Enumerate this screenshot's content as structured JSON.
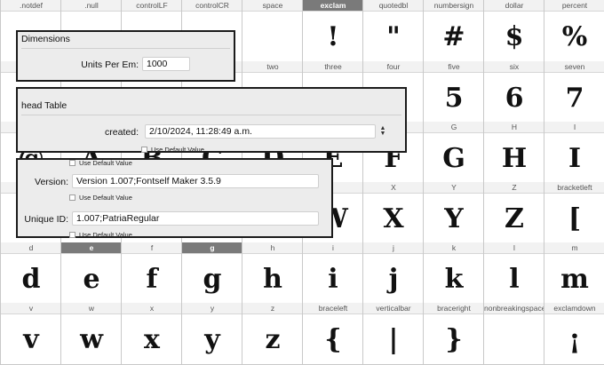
{
  "glyph_grid": {
    "rows": [
      [
        "|.notdef|",
        "|.null|",
        "|controlLF|",
        "|controlCR|",
        "|space|",
        "!exclam!",
        "\"quotedbl\"",
        "#numbersign#",
        "$dollar$",
        "%percent%"
      ],
      [
        "",
        "",
        "",
        "",
        "two",
        "three",
        "four",
        "five",
        "six",
        "seven"
      ],
      [
        "",
        "",
        "",
        "",
        "",
        "",
        "",
        "G",
        "H",
        "I"
      ],
      [
        "",
        "",
        "",
        "",
        "",
        "",
        "X",
        "Y",
        "Z",
        "bracketleft"
      ],
      [
        "d",
        "e",
        "f",
        "g",
        "h",
        "i",
        "j",
        "k",
        "l",
        "m"
      ],
      [
        "v",
        "w",
        "x",
        "y",
        "z",
        "braceleft",
        "verticalbar",
        "braceright",
        "nonbreakingspace",
        "exclamdown"
      ]
    ],
    "labels": [
      [
        ".notdef",
        ".null",
        "controlLF",
        "controlCR",
        "space",
        "exclam",
        "quotedbl",
        "numbersign",
        "dollar",
        "percent"
      ],
      [
        "",
        "",
        "",
        "",
        "two",
        "three",
        "four",
        "five",
        "six",
        "seven"
      ],
      [
        "",
        "",
        "",
        "",
        "",
        "",
        "",
        "G",
        "H",
        "I"
      ],
      [
        "",
        "",
        "",
        "",
        "",
        "",
        "X",
        "Y",
        "Z",
        "bracketleft"
      ],
      [
        "d",
        "e",
        "f",
        "g",
        "h",
        "i",
        "j",
        "k",
        "l",
        "m"
      ],
      [
        "v",
        "w",
        "x",
        "y",
        "z",
        "braceleft",
        "verticalbar",
        "braceright",
        "nonbreakingspace",
        "exclamdown"
      ]
    ],
    "glyphs": [
      [
        "",
        "",
        "",
        "",
        "",
        "!",
        "\"",
        "#",
        "$",
        "%"
      ],
      [
        "",
        "",
        "",
        "",
        "",
        "",
        "",
        "5",
        "6",
        "7"
      ],
      [
        "@",
        "A",
        "B",
        "C",
        "D",
        "E",
        "F",
        "G",
        "H",
        "I"
      ],
      [
        "",
        "",
        "",
        "",
        "",
        "W",
        "X",
        "Y",
        "Z",
        "["
      ],
      [
        "d",
        "e",
        "f",
        "g",
        "h",
        "i",
        "j",
        "k",
        "l",
        "m"
      ],
      [
        "v",
        "w",
        "x",
        "y",
        "z",
        "{",
        "|",
        "}",
        "",
        "¡"
      ]
    ],
    "selected": [
      "exclam",
      "e",
      "g"
    ]
  },
  "dimensions_panel": {
    "title": "Dimensions",
    "units_per_em_label": "Units Per Em:",
    "units_per_em_value": "1000"
  },
  "head_table_panel": {
    "title": "head Table",
    "created_label": "created:",
    "created_value": "2/10/2024,  11:28:49 a.m.",
    "use_default_label": "Use Default Value"
  },
  "name_panel": {
    "top_default_label": "Use Default Value",
    "version_label": "Version:",
    "version_value": "Version 1.007;Fontself Maker 3.5.9",
    "version_default_label": "Use Default Value",
    "unique_id_label": "Unique ID:",
    "unique_id_value": "1.007;PatriaRegular",
    "unique_id_default_label": "Use Default Value"
  },
  "icons": {
    "created_stepper": "up-down-stepper-icon"
  }
}
